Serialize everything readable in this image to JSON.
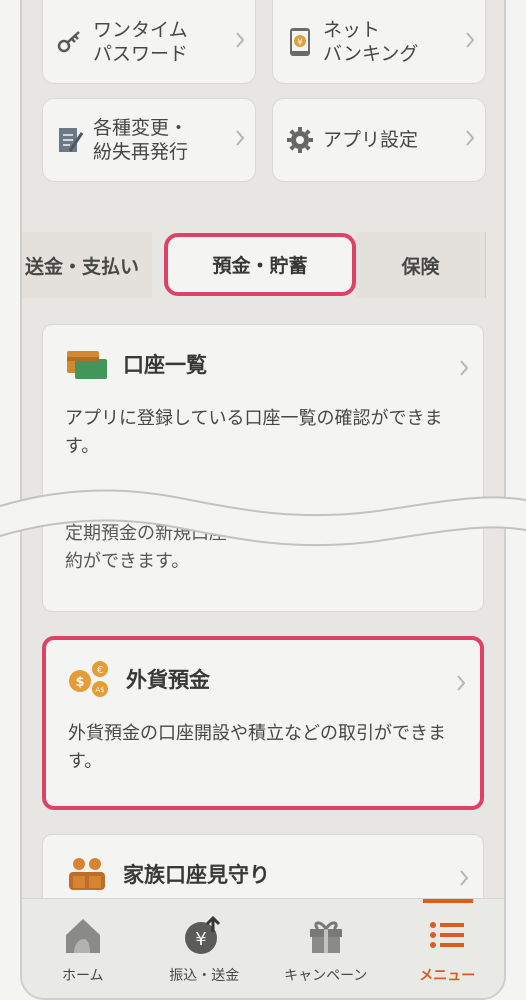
{
  "tiles": [
    {
      "label": "ワンタイム\nパスワード",
      "icon": "key-icon"
    },
    {
      "label": "ネット\nバンキング",
      "icon": "smartphone-yen-icon"
    },
    {
      "label": "各種変更・\n紛失再発行",
      "icon": "document-pen-icon"
    },
    {
      "label": "アプリ設定",
      "icon": "gear-icon"
    }
  ],
  "tabs": {
    "left": "送金・支払い",
    "active": "預金・貯蓄",
    "right": "保険"
  },
  "cards": {
    "account_list": {
      "title": "口座一覧",
      "desc": "アプリに登録している口座一覧の確認ができます。",
      "icon": "bankbook-icon"
    },
    "time_deposit": {
      "desc_fragment_1": "定期預金の新規口座",
      "desc_fragment_2": "約ができます。"
    },
    "foreign_deposit": {
      "title": "外貨預金",
      "desc": "外貨預金の口座開設や積立などの取引ができます。",
      "icon": "currency-coins-icon"
    },
    "family_watch": {
      "title": "家族口座見守り",
      "icon": "family-icon"
    }
  },
  "bottom_nav": [
    {
      "label": "ホーム",
      "icon": "home-icon"
    },
    {
      "label": "振込・送金",
      "icon": "yen-transfer-icon"
    },
    {
      "label": "キャンペーン",
      "icon": "gift-icon"
    },
    {
      "label": "メニュー",
      "icon": "menu-list-icon",
      "active": true
    }
  ],
  "colors": {
    "highlight": "#e63d66",
    "accent": "#e25b1e",
    "tab_accent": "#d9a46d"
  }
}
